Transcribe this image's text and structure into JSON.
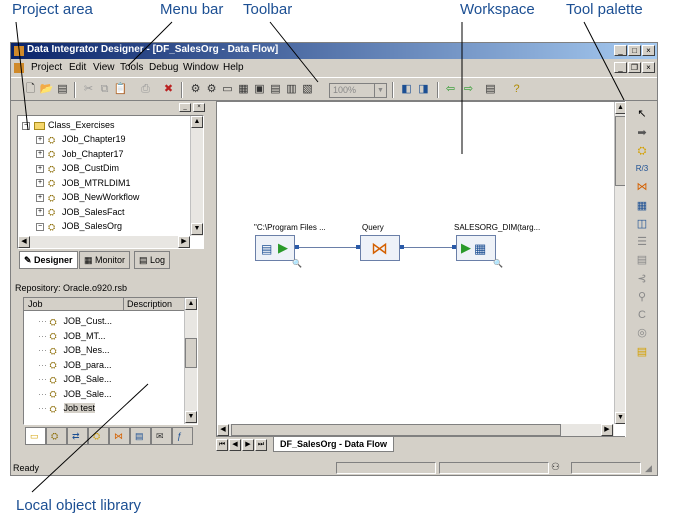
{
  "callouts": {
    "project_area": "Project area",
    "menu_bar": "Menu bar",
    "toolbar": "Toolbar",
    "workspace": "Workspace",
    "tool_palette": "Tool palette",
    "local_object_library": "Local object library"
  },
  "window": {
    "title": "Data Integrator Designer - [DF_SalesOrg - Data Flow]"
  },
  "menu": [
    "Project",
    "Edit",
    "View",
    "Tools",
    "Debug",
    "Window",
    "Help"
  ],
  "toolbar": {
    "zoom_value": "100%"
  },
  "project_tree": {
    "root": "Class_Exercises",
    "items": [
      "JOb_Chapter19",
      "Job_Chapter17",
      "JOB_CustDim",
      "JOB_MTRLDIM1",
      "JOB_NewWorkflow",
      "JOB_SalesFact",
      "JOB_SalesOrg"
    ]
  },
  "project_tabs": [
    "Designer",
    "Monitor",
    "Log"
  ],
  "repository": {
    "label": "Repository: Oracle.o920.rsb",
    "columns": [
      "Job",
      "Description"
    ],
    "items": [
      "JOB_Cust...",
      "JOB_MT...",
      "JOB_Nes...",
      "JOB_para...",
      "JOB_Sale...",
      "JOB_Sale...",
      "Job test"
    ]
  },
  "dataflow": {
    "source_label": "\"C:\\Program Files ...",
    "query_label": "Query",
    "target_label": "SALESORG_DIM(targ..."
  },
  "workspace_tab": "DF_SalesOrg - Data Flow",
  "status": {
    "text": "Ready"
  }
}
